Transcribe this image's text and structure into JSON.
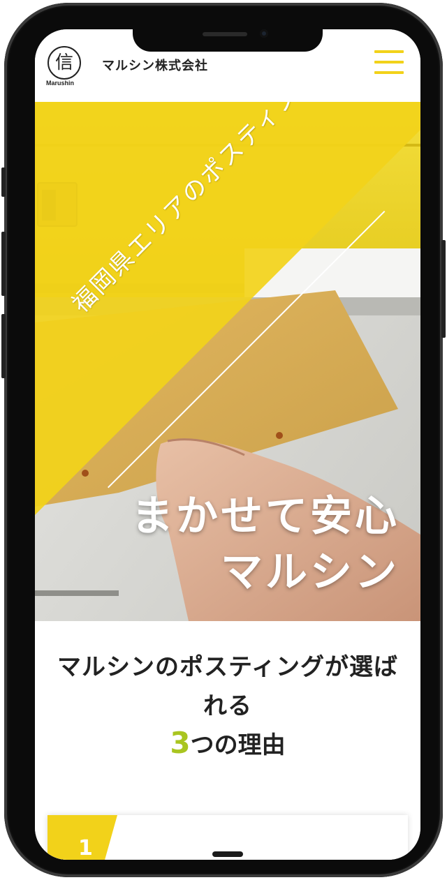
{
  "header": {
    "logo_glyph": "信",
    "logo_sub": "Marushin",
    "company_name": "マルシン株式会社"
  },
  "hero": {
    "tagline": "福岡県エリアのポスティングなら",
    "headline_line1": "まかせて安心",
    "headline_line2": "マルシン"
  },
  "reasons": {
    "title": "マルシンのポスティングが選ばれる",
    "number": "3",
    "subtitle_rest": "つの理由",
    "first_card_number": "1"
  },
  "colors": {
    "accent_yellow": "#f2d21a",
    "accent_green": "#a9c520",
    "text_dark": "#222222"
  },
  "icons": {
    "menu": "hamburger-icon"
  }
}
